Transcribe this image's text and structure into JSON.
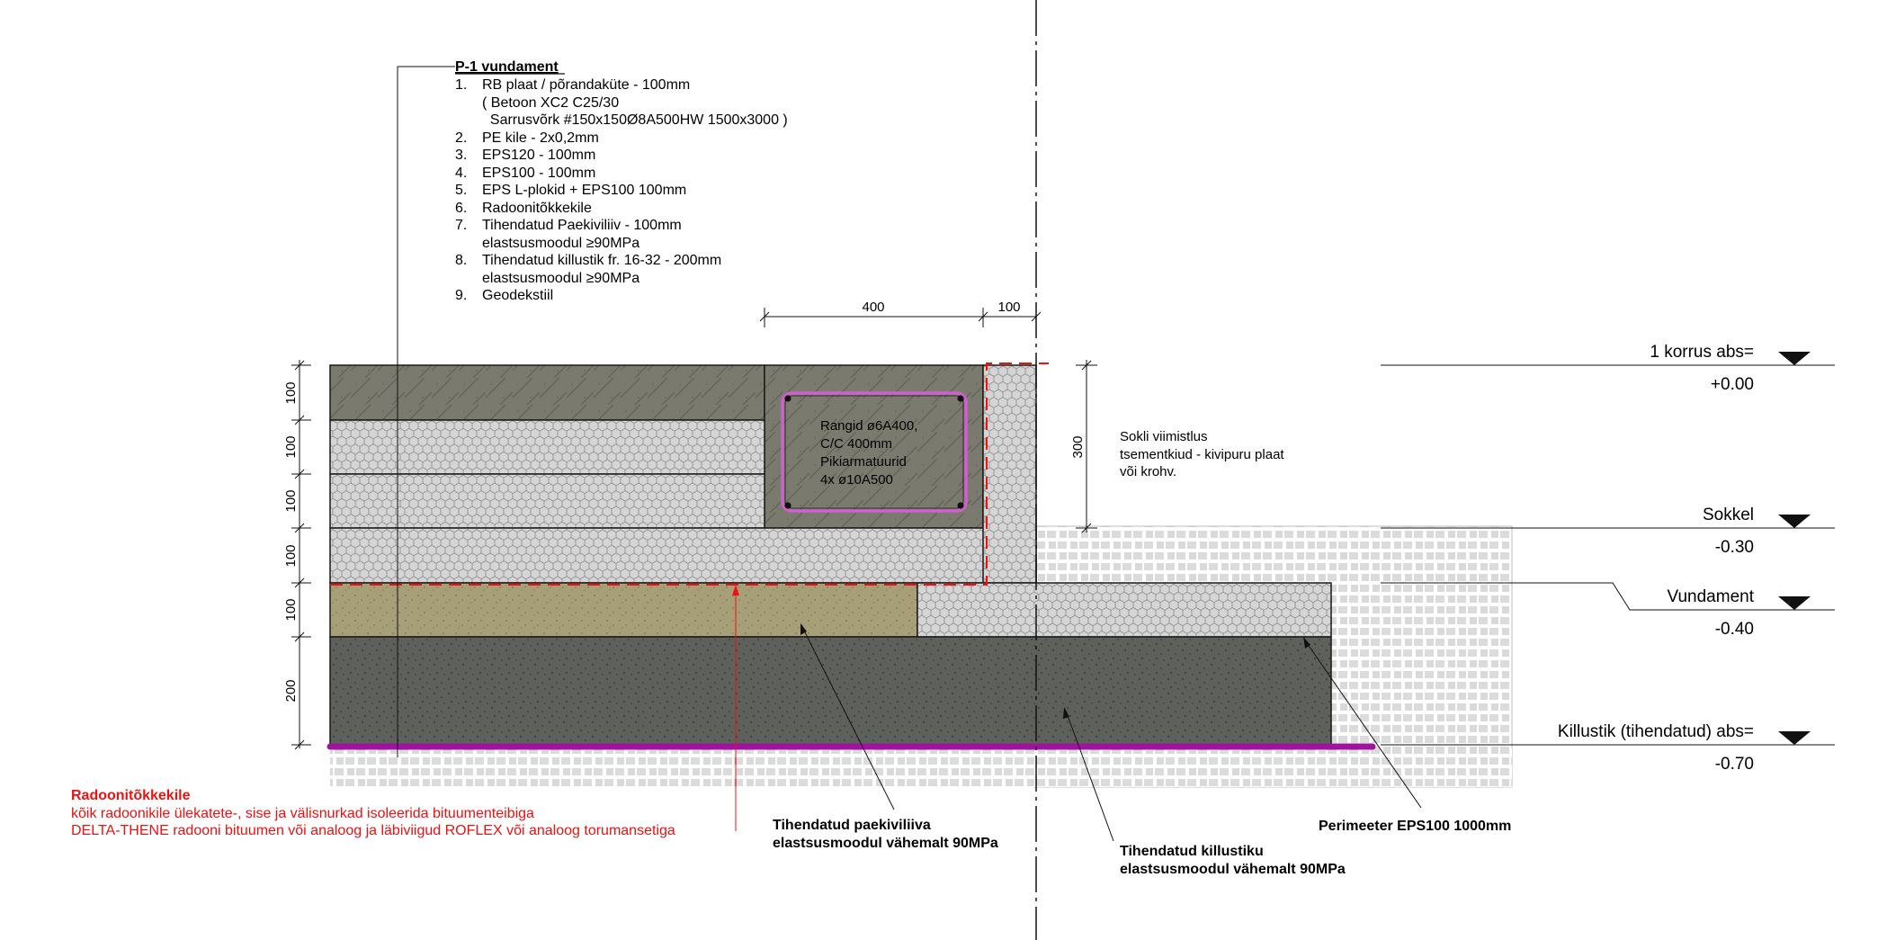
{
  "spec": {
    "title": "P-1 vundament",
    "items": [
      {
        "num": "1.",
        "lines": [
          "RB plaat / põrandaküte - 100mm",
          "( Betoon XC2 C25/30",
          "  Sarrusvõrk #150x150Ø8A500HW 1500x3000 )"
        ]
      },
      {
        "num": "2.",
        "lines": [
          "PE kile - 2x0,2mm"
        ]
      },
      {
        "num": "3.",
        "lines": [
          "EPS120 - 100mm"
        ]
      },
      {
        "num": "4.",
        "lines": [
          "EPS100 - 100mm"
        ]
      },
      {
        "num": "5.",
        "lines": [
          "EPS L-plokid + EPS100 100mm"
        ]
      },
      {
        "num": "6.",
        "lines": [
          "Radoonitõkkekile"
        ]
      },
      {
        "num": "7.",
        "lines": [
          "Tihendatud Paekiviliiv - 100mm",
          "elastsusmoodul  ≥90MPa"
        ]
      },
      {
        "num": "8.",
        "lines": [
          "Tihendatud killustik fr. 16-32 - 200mm",
          "elastsusmoodul  ≥90MPa"
        ]
      },
      {
        "num": "9.",
        "lines": [
          "Geodekstiil"
        ]
      }
    ]
  },
  "dimensions": {
    "top": [
      "400",
      "100"
    ],
    "left": [
      "100",
      "100",
      "100",
      "100",
      "100",
      "200"
    ],
    "plinth": "300"
  },
  "beam_note": [
    "Rangid ø6A400,",
    " C/C 400mm",
    "Pikiarmatuurid",
    "4x ø10A500"
  ],
  "plinth_note": [
    "Sokli viimistlus",
    "tsementkiud - kivipuru plaat",
    "või krohv."
  ],
  "levels": [
    {
      "name": "1 korrus abs=",
      "value": "+0.00"
    },
    {
      "name": "Sokkel",
      "value": "-0.30"
    },
    {
      "name": "Vundament",
      "value": "-0.40"
    },
    {
      "name": "Killustik (tihendatud) abs=",
      "value": "-0.70"
    }
  ],
  "radon_note": {
    "title": "Radoonitõkkekile",
    "lines": [
      "kõik radoonikile ülekatete-, sise ja välisnurkad isoleerida bituumenteibiga",
      "DELTA-THENE radooni bituumen või analoog ja läbiviigud ROFLEX või analoog torumansetiga"
    ]
  },
  "callouts": {
    "limestone": [
      "Tihendatud paekiviliiva",
      "elastsusmoodul vähemalt 90MPa"
    ],
    "gravel": [
      "Tihendatud killustiku",
      "elastsusmoodul vähemalt 90MPa"
    ],
    "perimeter": [
      "Perimeeter EPS100 1000mm"
    ]
  },
  "colors": {
    "concrete": "#7a7b6e",
    "insulation": "#d5d5d5",
    "limestone_sand": "#a69f78",
    "gravel": "#5e605c",
    "geotextile": "#a0139e",
    "radon_membrane": "#ee1111",
    "rebar_cage": "#d060d0"
  }
}
